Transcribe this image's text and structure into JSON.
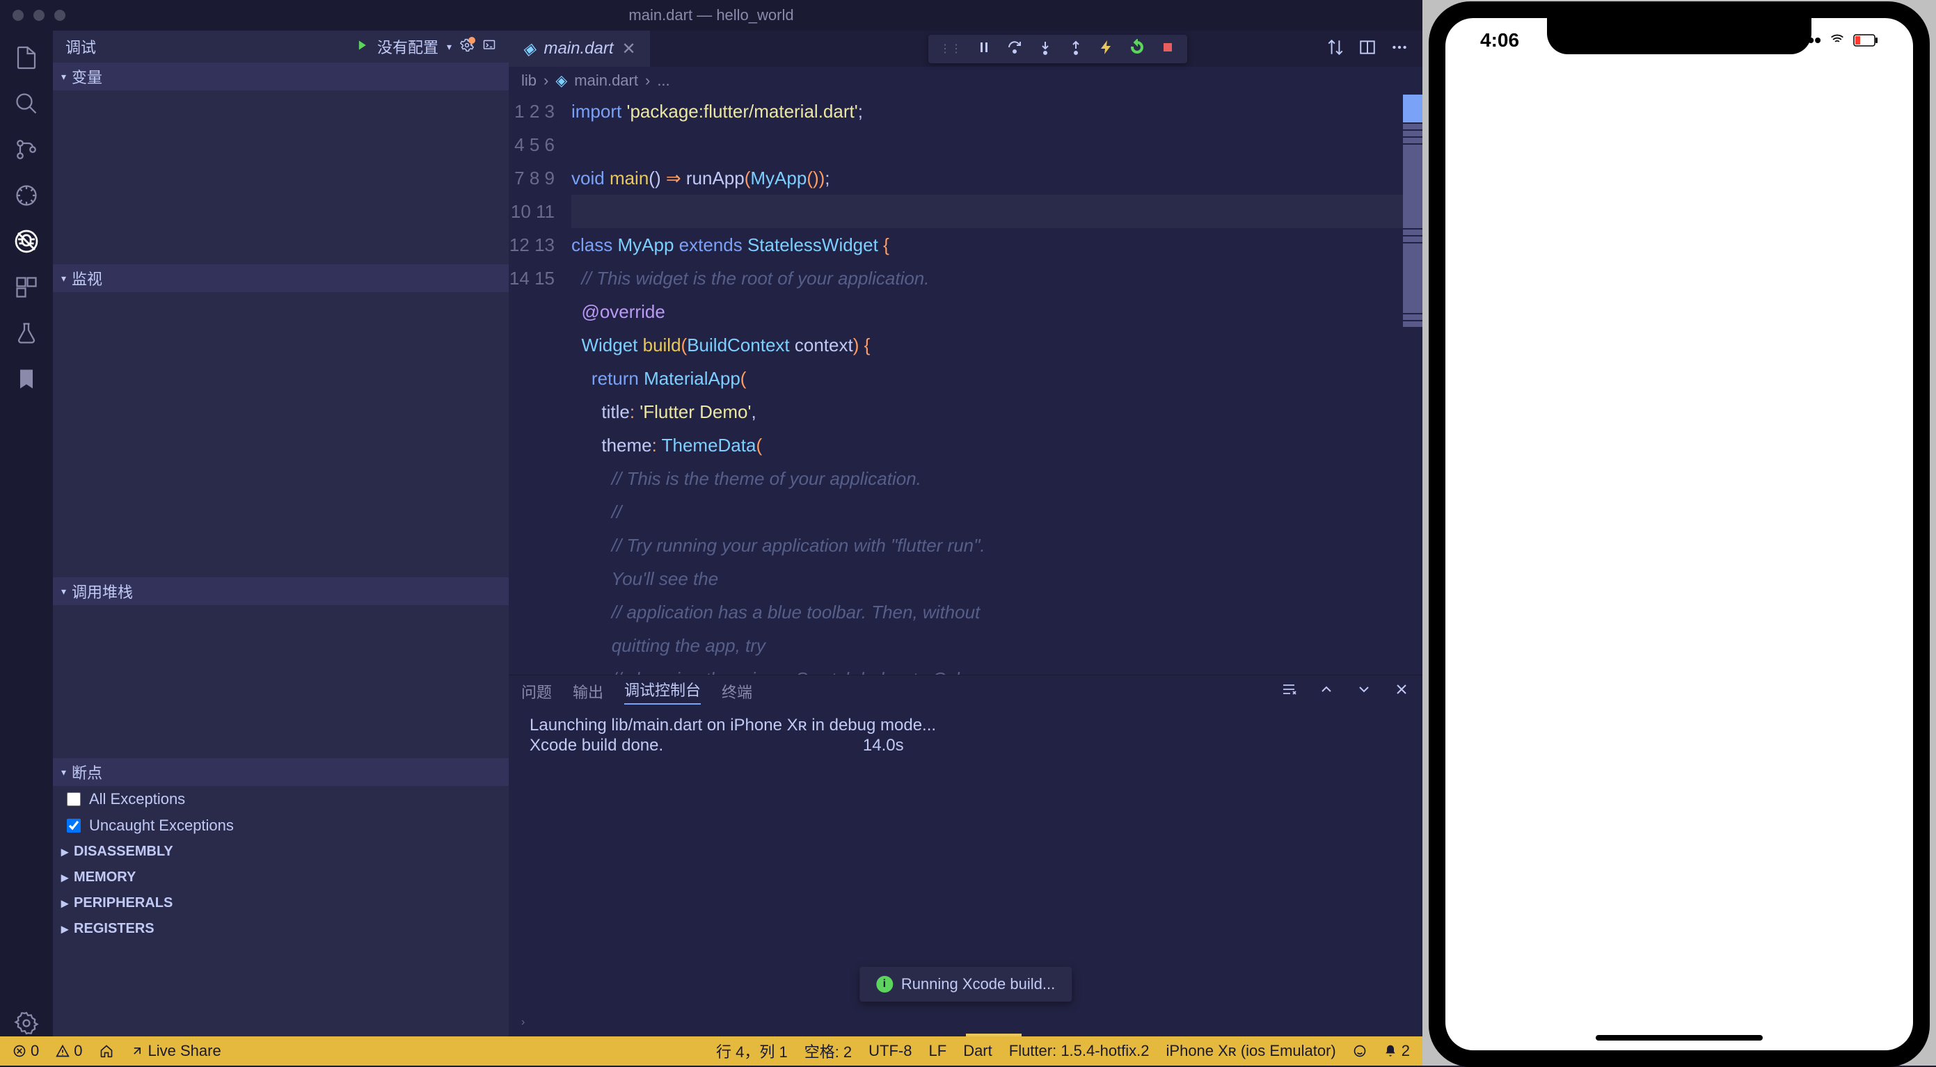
{
  "titlebar": {
    "title": "main.dart — hello_world"
  },
  "sidebar": {
    "debug_label": "调试",
    "config": "没有配置",
    "sections": {
      "variables": "变量",
      "watch": "监视",
      "callstack": "调用堆栈",
      "breakpoints": "断点"
    },
    "breakpoints": {
      "all": "All Exceptions",
      "uncaught": "Uncaught Exceptions"
    },
    "subs": {
      "disassembly": "DISASSEMBLY",
      "memory": "MEMORY",
      "peripherals": "PERIPHERALS",
      "registers": "REGISTERS"
    }
  },
  "tab": {
    "filename": "main.dart"
  },
  "breadcrumb": {
    "lib": "lib",
    "file": "main.dart",
    "more": "..."
  },
  "code": {
    "l1": "import 'package:flutter/material.dart';",
    "l3a": "void",
    "l3b": " main() ",
    "l3c": "⇒",
    "l3d": " runApp(",
    "l3e": "MyApp",
    "l3f": "());",
    "l5a": "class ",
    "l5b": "MyApp",
    "l5c": " extends ",
    "l5d": "StatelessWidget",
    "l5e": " {",
    "l6": "  // This widget is the root of your application.",
    "l7": "  @override",
    "l8a": "  Widget ",
    "l8b": "build",
    "l8c": "(",
    "l8d": "BuildContext",
    "l8e": " context",
    "l8f": ")",
    "l8g": " {",
    "l9a": "    return ",
    "l9b": "MaterialApp",
    "l9c": "(",
    "l10a": "      title",
    "l10b": ": ",
    "l10c": "'Flutter Demo'",
    "l10d": ",",
    "l11a": "      theme",
    "l11b": ": ",
    "l11c": "ThemeData",
    "l11d": "(",
    "l12": "        // This is the theme of your application.",
    "l13": "        //",
    "l14": "        // Try running your application with \"flutter run\". You'll see the",
    "l15": "        // application has a blue toolbar. Then, without quitting the app, try",
    "l16": "        // changing the primarySwatch below to Colors.green"
  },
  "panel": {
    "tabs": {
      "problems": "问题",
      "output": "输出",
      "debug_console": "调试控制台",
      "terminal": "终端"
    },
    "lines": {
      "l1": "Launching lib/main.dart on iPhone Xʀ in debug mode...",
      "l2": "Xcode build done.                                           14.0s"
    }
  },
  "toast": {
    "message": "Running Xcode build..."
  },
  "statusbar": {
    "errors": "0",
    "warnings": "0",
    "liveshare": "Live Share",
    "cursor": "行 4，列 1",
    "spaces": "空格: 2",
    "encoding": "UTF-8",
    "eol": "LF",
    "lang": "Dart",
    "flutter": "Flutter: 1.5.4-hotfix.2",
    "device": "iPhone Xʀ (ios Emulator)",
    "bell": "2"
  },
  "phone": {
    "time": "4:06"
  }
}
